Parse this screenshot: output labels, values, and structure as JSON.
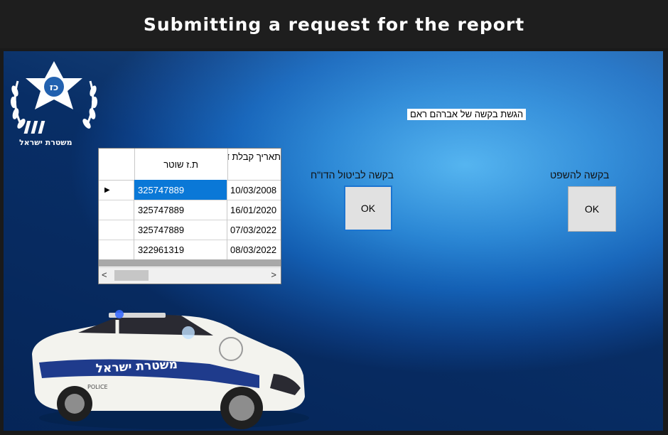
{
  "caption": "Submitting a request for the report",
  "logo": {
    "text": "משטרת ישראל",
    "icon": "police-star-emblem"
  },
  "header_label": "הגשת בקשה של אברהם ראם",
  "grid": {
    "columns": [
      "ת.ז שוטר",
      "תאריך קבלת דוח"
    ],
    "rows": [
      {
        "id": "325747889",
        "date": "10/03/2008",
        "selected": true
      },
      {
        "id": "325747889",
        "date": "16/01/2020"
      },
      {
        "id": "325747889",
        "date": "07/03/2022"
      },
      {
        "id": "322961319",
        "date": "08/03/2022"
      }
    ],
    "row_indicator": "▶",
    "scroll_left": "<",
    "scroll_right": ">"
  },
  "buttons": {
    "cancel_label": "בקשה לביטול הדו\"ח",
    "cancel_ok": "OK",
    "court_label": "בקשה להשפט",
    "court_ok": "OK"
  },
  "car": {
    "text": "משטרת ישראל",
    "police": "POLICE"
  },
  "colors": {
    "selection": "#0a78d7",
    "background_blue": "#2a86d4"
  }
}
